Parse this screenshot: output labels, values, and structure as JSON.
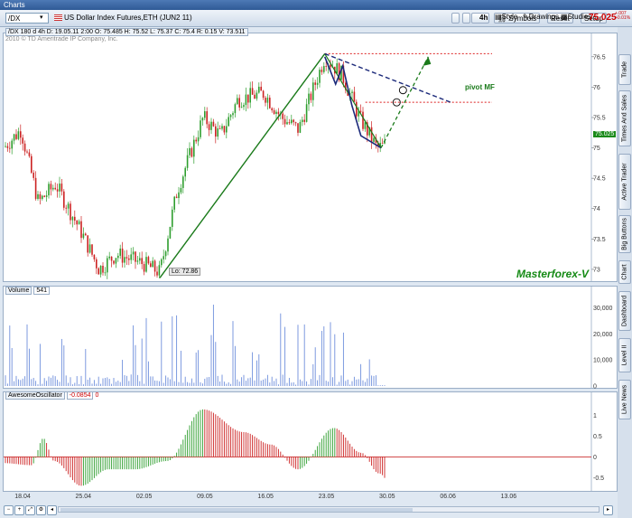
{
  "window": {
    "title": "Charts"
  },
  "toolbar": {
    "symbol": "/DX",
    "description": "US Dollar Index Futures,ETH (JUN2 11)",
    "symbols": "Symbols",
    "reset": "Reset",
    "setup": "Setup",
    "period": "4h",
    "style": "Style",
    "drawings": "Drawings",
    "studies": "Studies",
    "last_price": "75.025",
    "change_top": "+.007",
    "change_bottom": "+0.01%"
  },
  "price_panel": {
    "header": "/DX 180 d 4h  D: 19.05.11 2:00  O: 75.485  H: 75.52  L: 75.37  C: 75.4  R: 0.15  V: 73.511",
    "copyright": "2010 © TD Ameritrade IP Company, Inc.",
    "watermark": "Masterforex-V",
    "low_label": "Lo: 72.86",
    "pivot_label": "pivot MF",
    "current_price_tag": "75.025",
    "price_ticks": [
      "76.5",
      "76",
      "75.5",
      "75",
      "74.5",
      "74",
      "73.5",
      "73"
    ]
  },
  "volume_panel": {
    "label": "Volume",
    "value": "541",
    "ticks": [
      "30,000",
      "20,000",
      "10,000",
      "0"
    ]
  },
  "ao_panel": {
    "label": "AwesomeOscillator",
    "value": "-0.0854",
    "value2": "0",
    "ticks": [
      "1",
      "0.5",
      "0",
      "-0.5"
    ]
  },
  "x_ticks": [
    "18.04",
    "25.04",
    "02.05",
    "09.05",
    "16.05",
    "23.05",
    "30.05",
    "06.06",
    "13.06"
  ],
  "side_tabs": [
    "Trade",
    "Times And Sales",
    "Active Trader",
    "Big Buttons",
    "Chart",
    "Dashboard",
    "Level II",
    "Live News"
  ],
  "colors": {
    "up": "#2e9e2e",
    "down": "#cc2222",
    "trend": "#1a7a1a",
    "fan": "#1c2a7a",
    "pivot": "#dd2222",
    "volume": "#6f8fdc"
  },
  "chart_data": [
    {
      "type": "candlestick",
      "name": "price",
      "x_labels": [
        "18.04",
        "25.04",
        "02.05",
        "09.05",
        "16.05",
        "23.05",
        "30.05",
        "06.06",
        "13.06"
      ],
      "ylim": [
        72.85,
        76.75
      ],
      "close_path": [
        {
          "x": "16.04",
          "y": 75.0
        },
        {
          "x": "18.04",
          "y": 75.3
        },
        {
          "x": "20.04",
          "y": 74.1
        },
        {
          "x": "22.04",
          "y": 74.4
        },
        {
          "x": "25.04",
          "y": 73.6
        },
        {
          "x": "27.04",
          "y": 73.0
        },
        {
          "x": "29.04",
          "y": 73.25
        },
        {
          "x": "02.05",
          "y": 73.1
        },
        {
          "x": "04.05",
          "y": 72.95
        },
        {
          "x": "06.05",
          "y": 74.3
        },
        {
          "x": "09.05",
          "y": 75.5
        },
        {
          "x": "11.05",
          "y": 75.2
        },
        {
          "x": "13.05",
          "y": 75.8
        },
        {
          "x": "16.05",
          "y": 75.9
        },
        {
          "x": "18.05",
          "y": 75.5
        },
        {
          "x": "20.05",
          "y": 75.3
        },
        {
          "x": "23.05",
          "y": 76.5
        },
        {
          "x": "25.05",
          "y": 76.2
        },
        {
          "x": "27.05",
          "y": 75.5
        },
        {
          "x": "29.05",
          "y": 75.0
        },
        {
          "x": "30.05",
          "y": 75.03
        }
      ],
      "annotations": {
        "low": 72.86,
        "pivot_level": 75.75,
        "high_level": 76.55
      }
    },
    {
      "type": "bar",
      "name": "Volume",
      "ylim": [
        0,
        35000
      ]
    },
    {
      "type": "bar",
      "name": "AwesomeOscillator",
      "ylim": [
        -0.8,
        1.3
      ],
      "last": -0.0854
    }
  ]
}
